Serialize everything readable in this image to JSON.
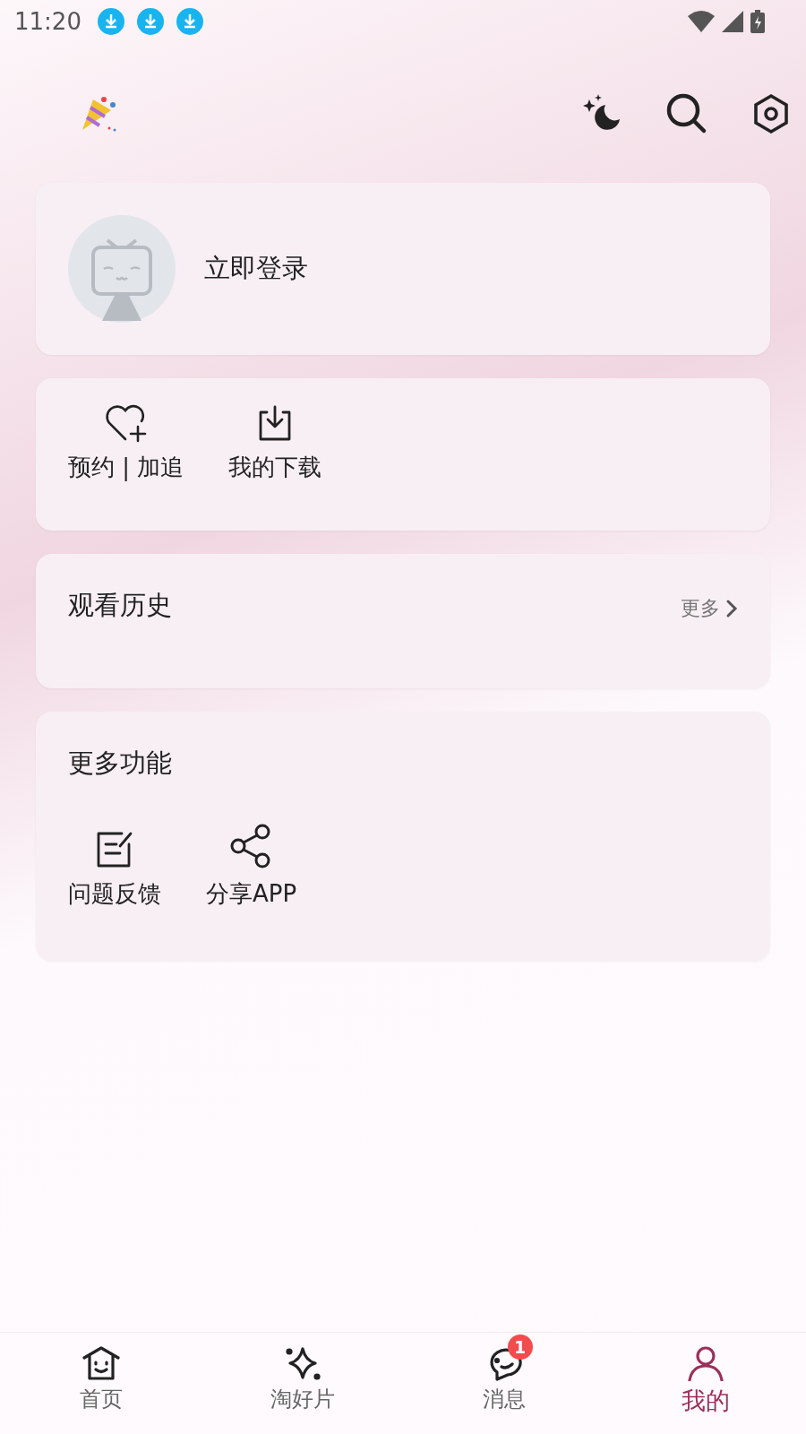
{
  "status_bar": {
    "time": "11:20"
  },
  "login": {
    "label": "立即登录"
  },
  "quick_actions": [
    {
      "label": "预约 | 加追",
      "kind": "heart"
    },
    {
      "label": "我的下载",
      "kind": "download"
    }
  ],
  "history": {
    "title": "观看历史",
    "more": "更多"
  },
  "more_features": {
    "title": "更多功能",
    "items": [
      {
        "label": "问题反馈",
        "kind": "feedback"
      },
      {
        "label": "分享APP",
        "kind": "share"
      }
    ]
  },
  "nav": [
    {
      "label": "首页",
      "kind": "home",
      "selected": false
    },
    {
      "label": "淘好片",
      "kind": "sparkle",
      "selected": false
    },
    {
      "label": "消息",
      "kind": "chat",
      "selected": false,
      "badge": "1"
    },
    {
      "label": "我的",
      "kind": "person",
      "selected": true
    }
  ]
}
